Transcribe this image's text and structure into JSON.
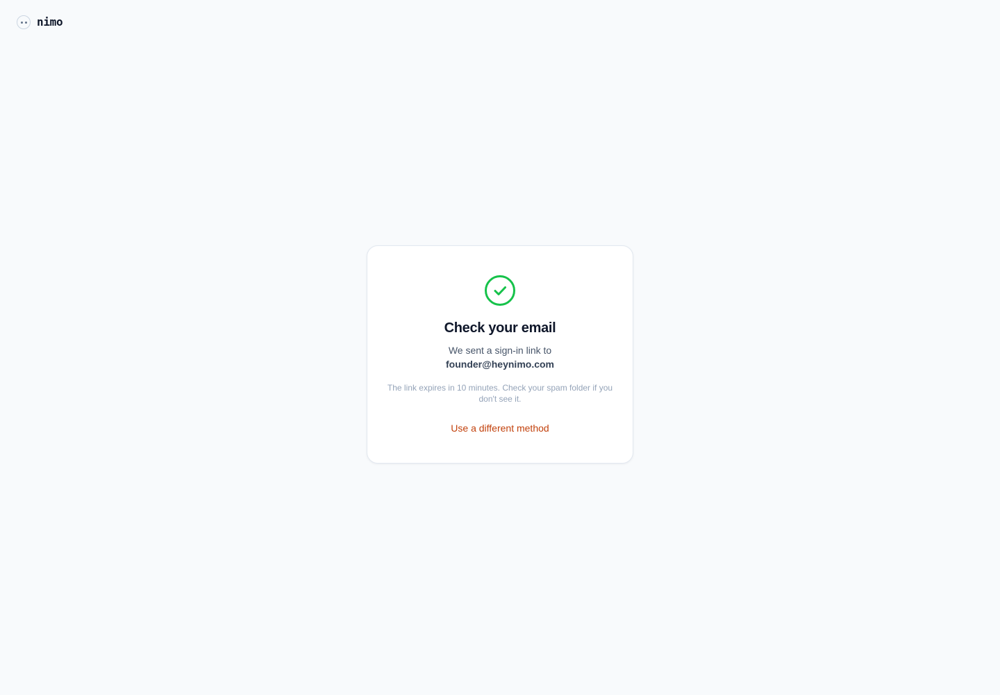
{
  "brand": {
    "name": "nimo",
    "logo_icon": "nimo-logo-icon"
  },
  "card": {
    "icon": "check-circle-icon",
    "title": "Check your email",
    "subtitle": "We sent a sign-in link to",
    "email": "founder@heynimo.com",
    "note": "The link expires in 10 minutes. Check your spam folder if you don't see it.",
    "alt_method_label": "Use a different method"
  },
  "colors": {
    "success": "#16c24a",
    "link": "#c2410c",
    "background": "#f8fafc"
  }
}
